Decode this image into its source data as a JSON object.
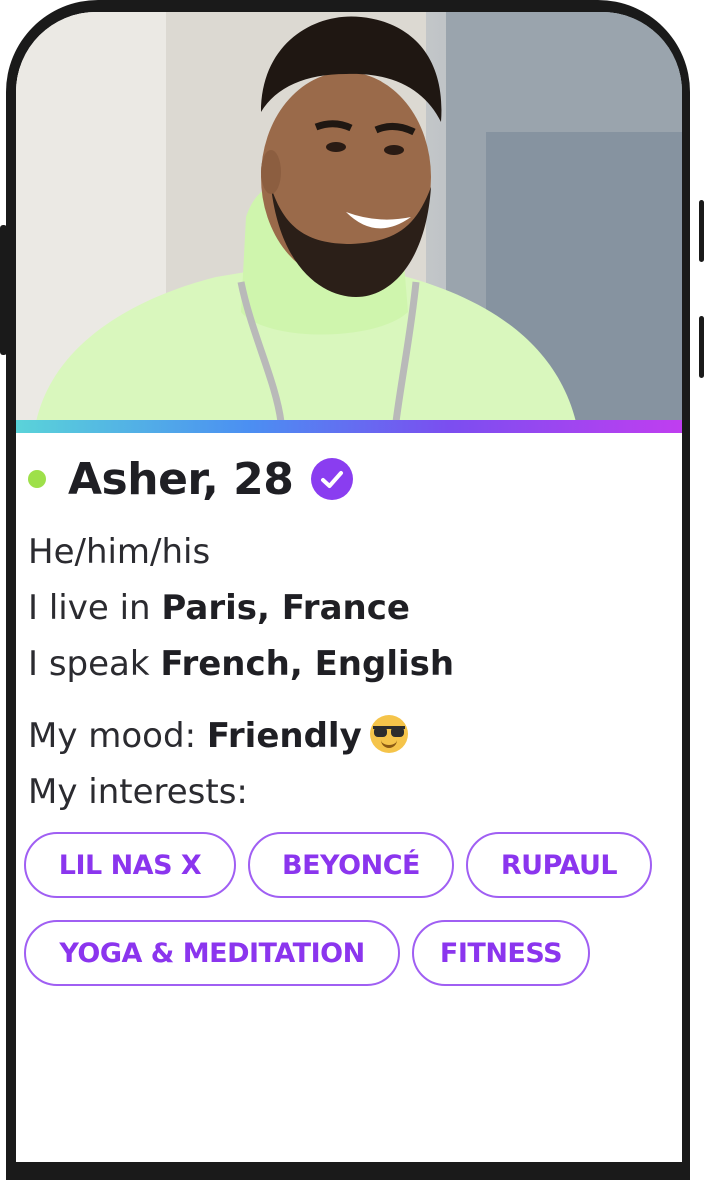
{
  "profile": {
    "name_age": "Asher, 28",
    "online": true,
    "verified": true,
    "pronouns": "He/him/his",
    "location_prefix": "I live in ",
    "location": "Paris, France",
    "languages_prefix": "I speak ",
    "languages": "French, English",
    "mood_prefix": "My mood: ",
    "mood": "Friendly",
    "mood_icon": "sunglasses-emoji-icon",
    "interests_label": "My interests:",
    "interests": [
      "LIL NAS X",
      "BEYONCÉ",
      "RUPAUL",
      "YOGA & MEDITATION",
      "FITNESS"
    ]
  },
  "colors": {
    "accent": "#8b35ee",
    "online": "#9ee04a",
    "gradient_bar": [
      "#5ad3d9",
      "#4b8ff2",
      "#7b4ef0",
      "#c03ef0"
    ]
  }
}
